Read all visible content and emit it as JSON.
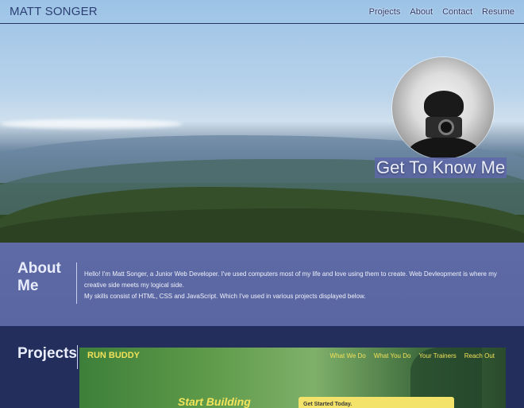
{
  "header": {
    "brand": "MATT SONGER",
    "links": [
      "Projects",
      "About",
      "Contact",
      "Resume"
    ]
  },
  "hero": {
    "cta": "Get To Know Me"
  },
  "about": {
    "title": "About Me",
    "paragraphs": [
      "Hello! I'm Matt Songer, a Junior Web Developer. I've used computers most of my life and love using them to create. Web Devleopment is where my creative side meets my logical side.",
      "My skills consist of HTML, CSS and JavaScript. Which I've used in various projects displayed below."
    ]
  },
  "projects": {
    "title": "Projects",
    "preview": {
      "site_title": "RUN BUDDY",
      "nav": [
        "What We Do",
        "What You Do",
        "Your Trainers",
        "Reach Out"
      ],
      "hero_text": "Start Building",
      "card_text": "Get Started Today."
    }
  }
}
